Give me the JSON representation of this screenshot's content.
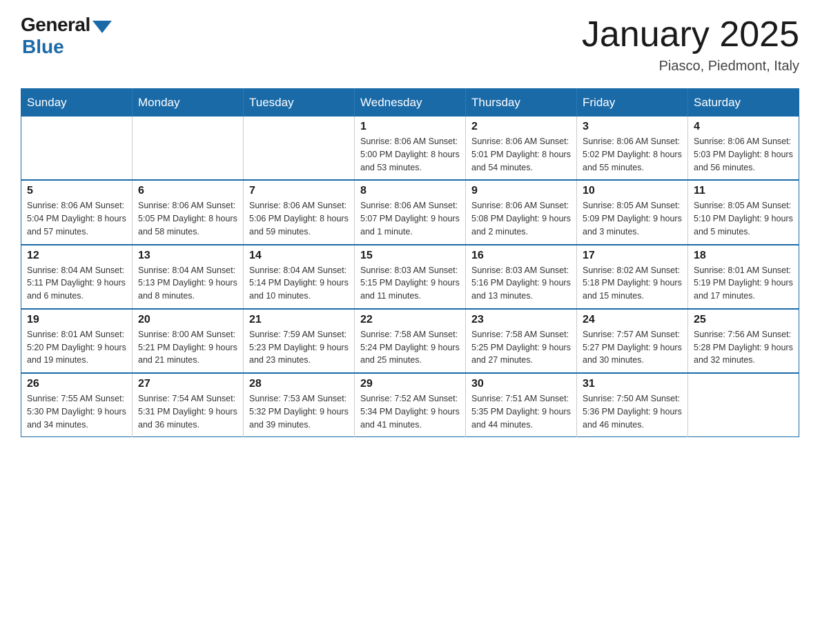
{
  "logo": {
    "general": "General",
    "blue": "Blue"
  },
  "title": "January 2025",
  "location": "Piasco, Piedmont, Italy",
  "headers": [
    "Sunday",
    "Monday",
    "Tuesday",
    "Wednesday",
    "Thursday",
    "Friday",
    "Saturday"
  ],
  "weeks": [
    [
      {
        "day": "",
        "info": ""
      },
      {
        "day": "",
        "info": ""
      },
      {
        "day": "",
        "info": ""
      },
      {
        "day": "1",
        "info": "Sunrise: 8:06 AM\nSunset: 5:00 PM\nDaylight: 8 hours\nand 53 minutes."
      },
      {
        "day": "2",
        "info": "Sunrise: 8:06 AM\nSunset: 5:01 PM\nDaylight: 8 hours\nand 54 minutes."
      },
      {
        "day": "3",
        "info": "Sunrise: 8:06 AM\nSunset: 5:02 PM\nDaylight: 8 hours\nand 55 minutes."
      },
      {
        "day": "4",
        "info": "Sunrise: 8:06 AM\nSunset: 5:03 PM\nDaylight: 8 hours\nand 56 minutes."
      }
    ],
    [
      {
        "day": "5",
        "info": "Sunrise: 8:06 AM\nSunset: 5:04 PM\nDaylight: 8 hours\nand 57 minutes."
      },
      {
        "day": "6",
        "info": "Sunrise: 8:06 AM\nSunset: 5:05 PM\nDaylight: 8 hours\nand 58 minutes."
      },
      {
        "day": "7",
        "info": "Sunrise: 8:06 AM\nSunset: 5:06 PM\nDaylight: 8 hours\nand 59 minutes."
      },
      {
        "day": "8",
        "info": "Sunrise: 8:06 AM\nSunset: 5:07 PM\nDaylight: 9 hours\nand 1 minute."
      },
      {
        "day": "9",
        "info": "Sunrise: 8:06 AM\nSunset: 5:08 PM\nDaylight: 9 hours\nand 2 minutes."
      },
      {
        "day": "10",
        "info": "Sunrise: 8:05 AM\nSunset: 5:09 PM\nDaylight: 9 hours\nand 3 minutes."
      },
      {
        "day": "11",
        "info": "Sunrise: 8:05 AM\nSunset: 5:10 PM\nDaylight: 9 hours\nand 5 minutes."
      }
    ],
    [
      {
        "day": "12",
        "info": "Sunrise: 8:04 AM\nSunset: 5:11 PM\nDaylight: 9 hours\nand 6 minutes."
      },
      {
        "day": "13",
        "info": "Sunrise: 8:04 AM\nSunset: 5:13 PM\nDaylight: 9 hours\nand 8 minutes."
      },
      {
        "day": "14",
        "info": "Sunrise: 8:04 AM\nSunset: 5:14 PM\nDaylight: 9 hours\nand 10 minutes."
      },
      {
        "day": "15",
        "info": "Sunrise: 8:03 AM\nSunset: 5:15 PM\nDaylight: 9 hours\nand 11 minutes."
      },
      {
        "day": "16",
        "info": "Sunrise: 8:03 AM\nSunset: 5:16 PM\nDaylight: 9 hours\nand 13 minutes."
      },
      {
        "day": "17",
        "info": "Sunrise: 8:02 AM\nSunset: 5:18 PM\nDaylight: 9 hours\nand 15 minutes."
      },
      {
        "day": "18",
        "info": "Sunrise: 8:01 AM\nSunset: 5:19 PM\nDaylight: 9 hours\nand 17 minutes."
      }
    ],
    [
      {
        "day": "19",
        "info": "Sunrise: 8:01 AM\nSunset: 5:20 PM\nDaylight: 9 hours\nand 19 minutes."
      },
      {
        "day": "20",
        "info": "Sunrise: 8:00 AM\nSunset: 5:21 PM\nDaylight: 9 hours\nand 21 minutes."
      },
      {
        "day": "21",
        "info": "Sunrise: 7:59 AM\nSunset: 5:23 PM\nDaylight: 9 hours\nand 23 minutes."
      },
      {
        "day": "22",
        "info": "Sunrise: 7:58 AM\nSunset: 5:24 PM\nDaylight: 9 hours\nand 25 minutes."
      },
      {
        "day": "23",
        "info": "Sunrise: 7:58 AM\nSunset: 5:25 PM\nDaylight: 9 hours\nand 27 minutes."
      },
      {
        "day": "24",
        "info": "Sunrise: 7:57 AM\nSunset: 5:27 PM\nDaylight: 9 hours\nand 30 minutes."
      },
      {
        "day": "25",
        "info": "Sunrise: 7:56 AM\nSunset: 5:28 PM\nDaylight: 9 hours\nand 32 minutes."
      }
    ],
    [
      {
        "day": "26",
        "info": "Sunrise: 7:55 AM\nSunset: 5:30 PM\nDaylight: 9 hours\nand 34 minutes."
      },
      {
        "day": "27",
        "info": "Sunrise: 7:54 AM\nSunset: 5:31 PM\nDaylight: 9 hours\nand 36 minutes."
      },
      {
        "day": "28",
        "info": "Sunrise: 7:53 AM\nSunset: 5:32 PM\nDaylight: 9 hours\nand 39 minutes."
      },
      {
        "day": "29",
        "info": "Sunrise: 7:52 AM\nSunset: 5:34 PM\nDaylight: 9 hours\nand 41 minutes."
      },
      {
        "day": "30",
        "info": "Sunrise: 7:51 AM\nSunset: 5:35 PM\nDaylight: 9 hours\nand 44 minutes."
      },
      {
        "day": "31",
        "info": "Sunrise: 7:50 AM\nSunset: 5:36 PM\nDaylight: 9 hours\nand 46 minutes."
      },
      {
        "day": "",
        "info": ""
      }
    ]
  ]
}
